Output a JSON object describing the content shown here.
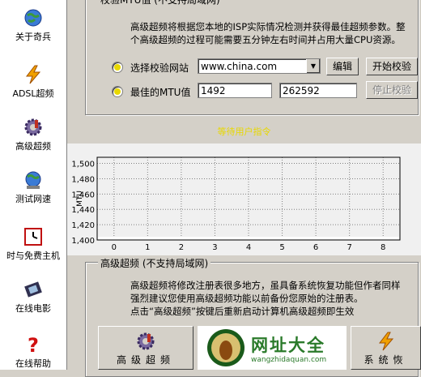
{
  "sidebar": {
    "items": [
      {
        "label": "关于奇兵",
        "icon": "globe-icon"
      },
      {
        "label": "ADSL超频",
        "icon": "lightning-icon"
      },
      {
        "label": "高级超频",
        "icon": "gear-icon"
      },
      {
        "label": "测试网速",
        "icon": "globe-network-icon"
      },
      {
        "label": "时与免费主机",
        "icon": "clock-icon"
      },
      {
        "label": "在线电影",
        "icon": "film-icon"
      },
      {
        "label": "在线帮助",
        "icon": "help-icon"
      }
    ]
  },
  "mtu_group": {
    "legend": "校验MTU值  (不支持局域网)",
    "description_line1": "高级超频将根据您本地的ISP实际情况检测并获得最佳超频参数。整",
    "description_line2": "个高级超频的过程可能需要五分钟左右时间并占用大量CPU资源。",
    "site_label": "选择校验网站",
    "site_value": "www.china.com",
    "edit_button": "编辑",
    "start_button": "开始校验",
    "mtu_label": "最佳的MTU值",
    "mtu_value": "1492",
    "mtu_value2": "262592",
    "stop_button": "停止校验"
  },
  "status_text": "等待用户指令",
  "chart_data": {
    "type": "line",
    "ylabel": "MTU",
    "xlabel": "",
    "title": "",
    "x_ticks": [
      0,
      1,
      2,
      3,
      4,
      5,
      6,
      7,
      8
    ],
    "y_ticks": [
      1400,
      1420,
      1440,
      1460,
      1480,
      1500
    ],
    "y_tick_labels": [
      "1,400",
      "1,420",
      "1,440",
      "1,460",
      "1,480",
      "1,500"
    ],
    "xlim": [
      -0.5,
      8.5
    ],
    "ylim": [
      1400,
      1508
    ],
    "grid": true,
    "series": []
  },
  "adv_group": {
    "legend": "高级超频  (不支持局域网)",
    "line1": "高级超频将修改注册表很多地方，虽具备系统恢复功能但作者同样",
    "line2": "强烈建议您使用高级超频功能以前备份您原始的注册表。",
    "line3": "点击“高级超频”按键后重新启动计算机高级超频即生效",
    "adv_button": "高级超频",
    "restore_button": "系统恢"
  },
  "ad": {
    "text": "网址大全",
    "url": "wangzhidaquan.com"
  },
  "colors": {
    "yellow_status": "#e8d800",
    "ad_green": "#2a7a2a"
  }
}
